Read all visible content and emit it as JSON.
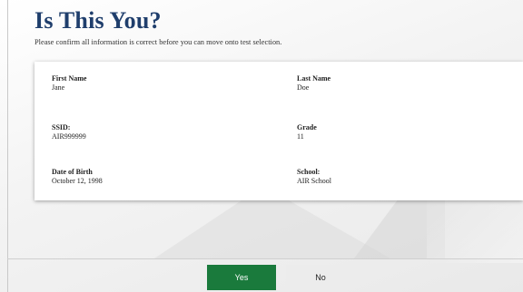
{
  "header": {
    "title": "Is This You?",
    "subtitle": "Please confirm all information is correct before you can move onto test selection."
  },
  "student": {
    "first_name_label": "First Name",
    "first_name": "Jane",
    "last_name_label": "Last Name",
    "last_name": "Doe",
    "ssid_label": "SSID:",
    "ssid": "AIR999999",
    "grade_label": "Grade",
    "grade": "11",
    "dob_label": "Date of Birth",
    "dob": "October 12, 1998",
    "school_label": "School:",
    "school": "AIR School"
  },
  "actions": {
    "yes_label": "Yes",
    "no_label": "No"
  },
  "colors": {
    "title": "#1f3e6c",
    "yes_button": "#1a7a3c",
    "no_button": "#ececec"
  }
}
